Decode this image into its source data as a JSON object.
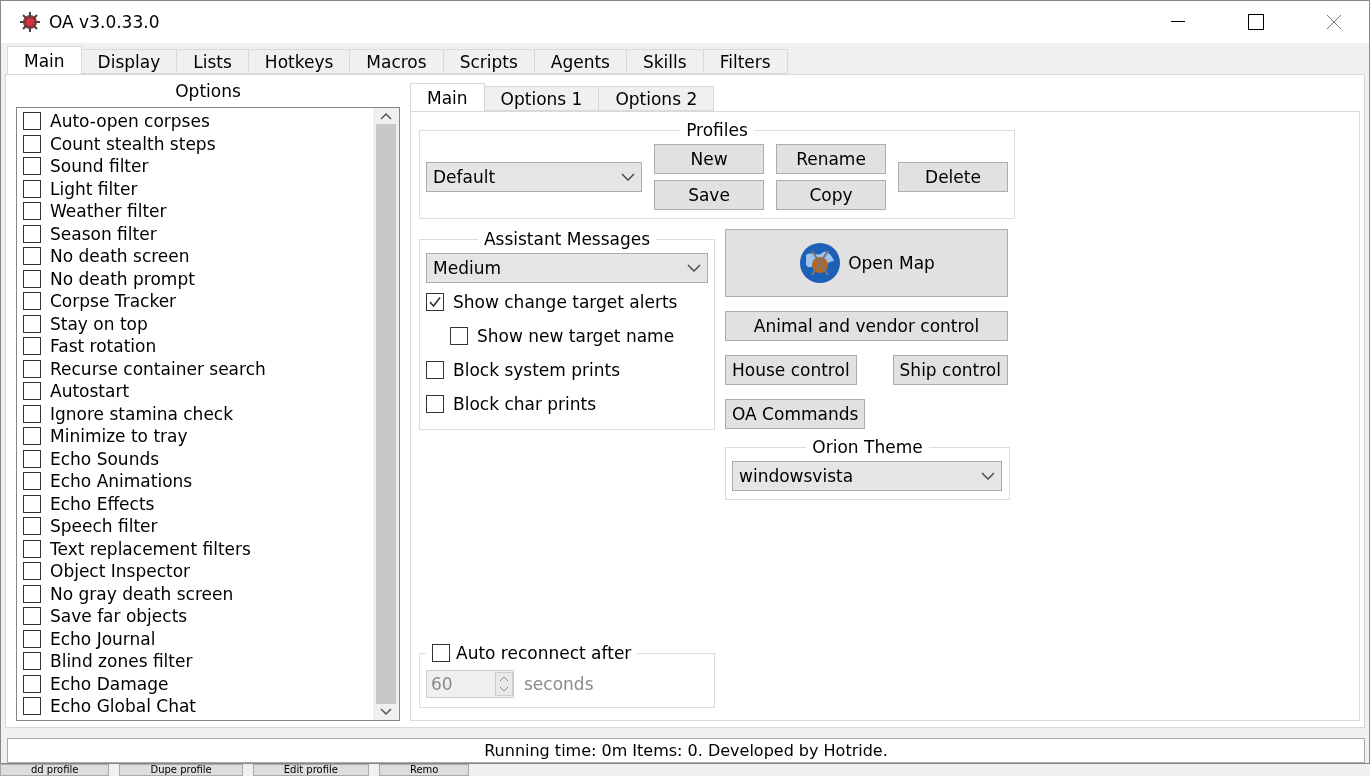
{
  "window": {
    "title": "OA v3.0.33.0"
  },
  "tabs": [
    {
      "label": "Main",
      "selected": true
    },
    {
      "label": "Display",
      "selected": false
    },
    {
      "label": "Lists",
      "selected": false
    },
    {
      "label": "Hotkeys",
      "selected": false
    },
    {
      "label": "Macros",
      "selected": false
    },
    {
      "label": "Scripts",
      "selected": false
    },
    {
      "label": "Agents",
      "selected": false
    },
    {
      "label": "Skills",
      "selected": false
    },
    {
      "label": "Filters",
      "selected": false
    }
  ],
  "options": {
    "title": "Options",
    "items": [
      {
        "label": "Auto-open corpses",
        "checked": false
      },
      {
        "label": "Count stealth steps",
        "checked": false
      },
      {
        "label": "Sound filter",
        "checked": false
      },
      {
        "label": "Light filter",
        "checked": false
      },
      {
        "label": "Weather filter",
        "checked": false
      },
      {
        "label": "Season filter",
        "checked": false
      },
      {
        "label": "No death screen",
        "checked": false
      },
      {
        "label": "No death prompt",
        "checked": false
      },
      {
        "label": "Corpse Tracker",
        "checked": false
      },
      {
        "label": "Stay on top",
        "checked": false
      },
      {
        "label": "Fast rotation",
        "checked": false
      },
      {
        "label": "Recurse container search",
        "checked": false
      },
      {
        "label": "Autostart",
        "checked": false
      },
      {
        "label": "Ignore stamina check",
        "checked": false
      },
      {
        "label": "Minimize to tray",
        "checked": false
      },
      {
        "label": "Echo Sounds",
        "checked": false
      },
      {
        "label": "Echo Animations",
        "checked": false
      },
      {
        "label": "Echo Effects",
        "checked": false
      },
      {
        "label": "Speech filter",
        "checked": false
      },
      {
        "label": "Text replacement filters",
        "checked": false
      },
      {
        "label": "Object Inspector",
        "checked": false
      },
      {
        "label": "No gray death screen",
        "checked": false
      },
      {
        "label": "Save far objects",
        "checked": false
      },
      {
        "label": "Echo Journal",
        "checked": false
      },
      {
        "label": "Blind zones filter",
        "checked": false
      },
      {
        "label": "Echo Damage",
        "checked": false
      },
      {
        "label": "Echo Global Chat",
        "checked": false
      }
    ]
  },
  "subtabs": [
    {
      "label": "Main",
      "selected": true
    },
    {
      "label": "Options 1",
      "selected": false
    },
    {
      "label": "Options 2",
      "selected": false
    }
  ],
  "profiles": {
    "title": "Profiles",
    "value": "Default",
    "buttons": [
      {
        "label": "New"
      },
      {
        "label": "Rename"
      },
      {
        "label": "Save"
      },
      {
        "label": "Copy"
      },
      {
        "label": "Delete"
      }
    ]
  },
  "assistant_messages": {
    "title": "Assistant Messages",
    "value": "Medium",
    "checkboxes": [
      {
        "label": "Show change target alerts",
        "checked": true,
        "children": [
          {
            "label": "Show new target name",
            "checked": false
          }
        ]
      },
      {
        "label": "Block system prints",
        "checked": false
      },
      {
        "label": "Block char prints",
        "checked": false
      }
    ]
  },
  "open_map": {
    "label": "Open Map"
  },
  "controls": [
    {
      "label": "Animal and vendor control"
    },
    {
      "label": "House control"
    },
    {
      "label": "Ship control"
    },
    {
      "label": "OA Commands"
    }
  ],
  "theme": {
    "title": "Orion Theme",
    "value": "windowsvista"
  },
  "auto_reconnect": {
    "label": "Auto reconnect after",
    "checked": false,
    "value": "60",
    "unit": "seconds",
    "disabled": true
  },
  "status_bar": "Running time: 0m Items: 0. Developed by Hotride.",
  "background_window": {
    "buttons": [
      "dd profile",
      "Dupe profile",
      "Edit profile",
      "Remo"
    ]
  }
}
